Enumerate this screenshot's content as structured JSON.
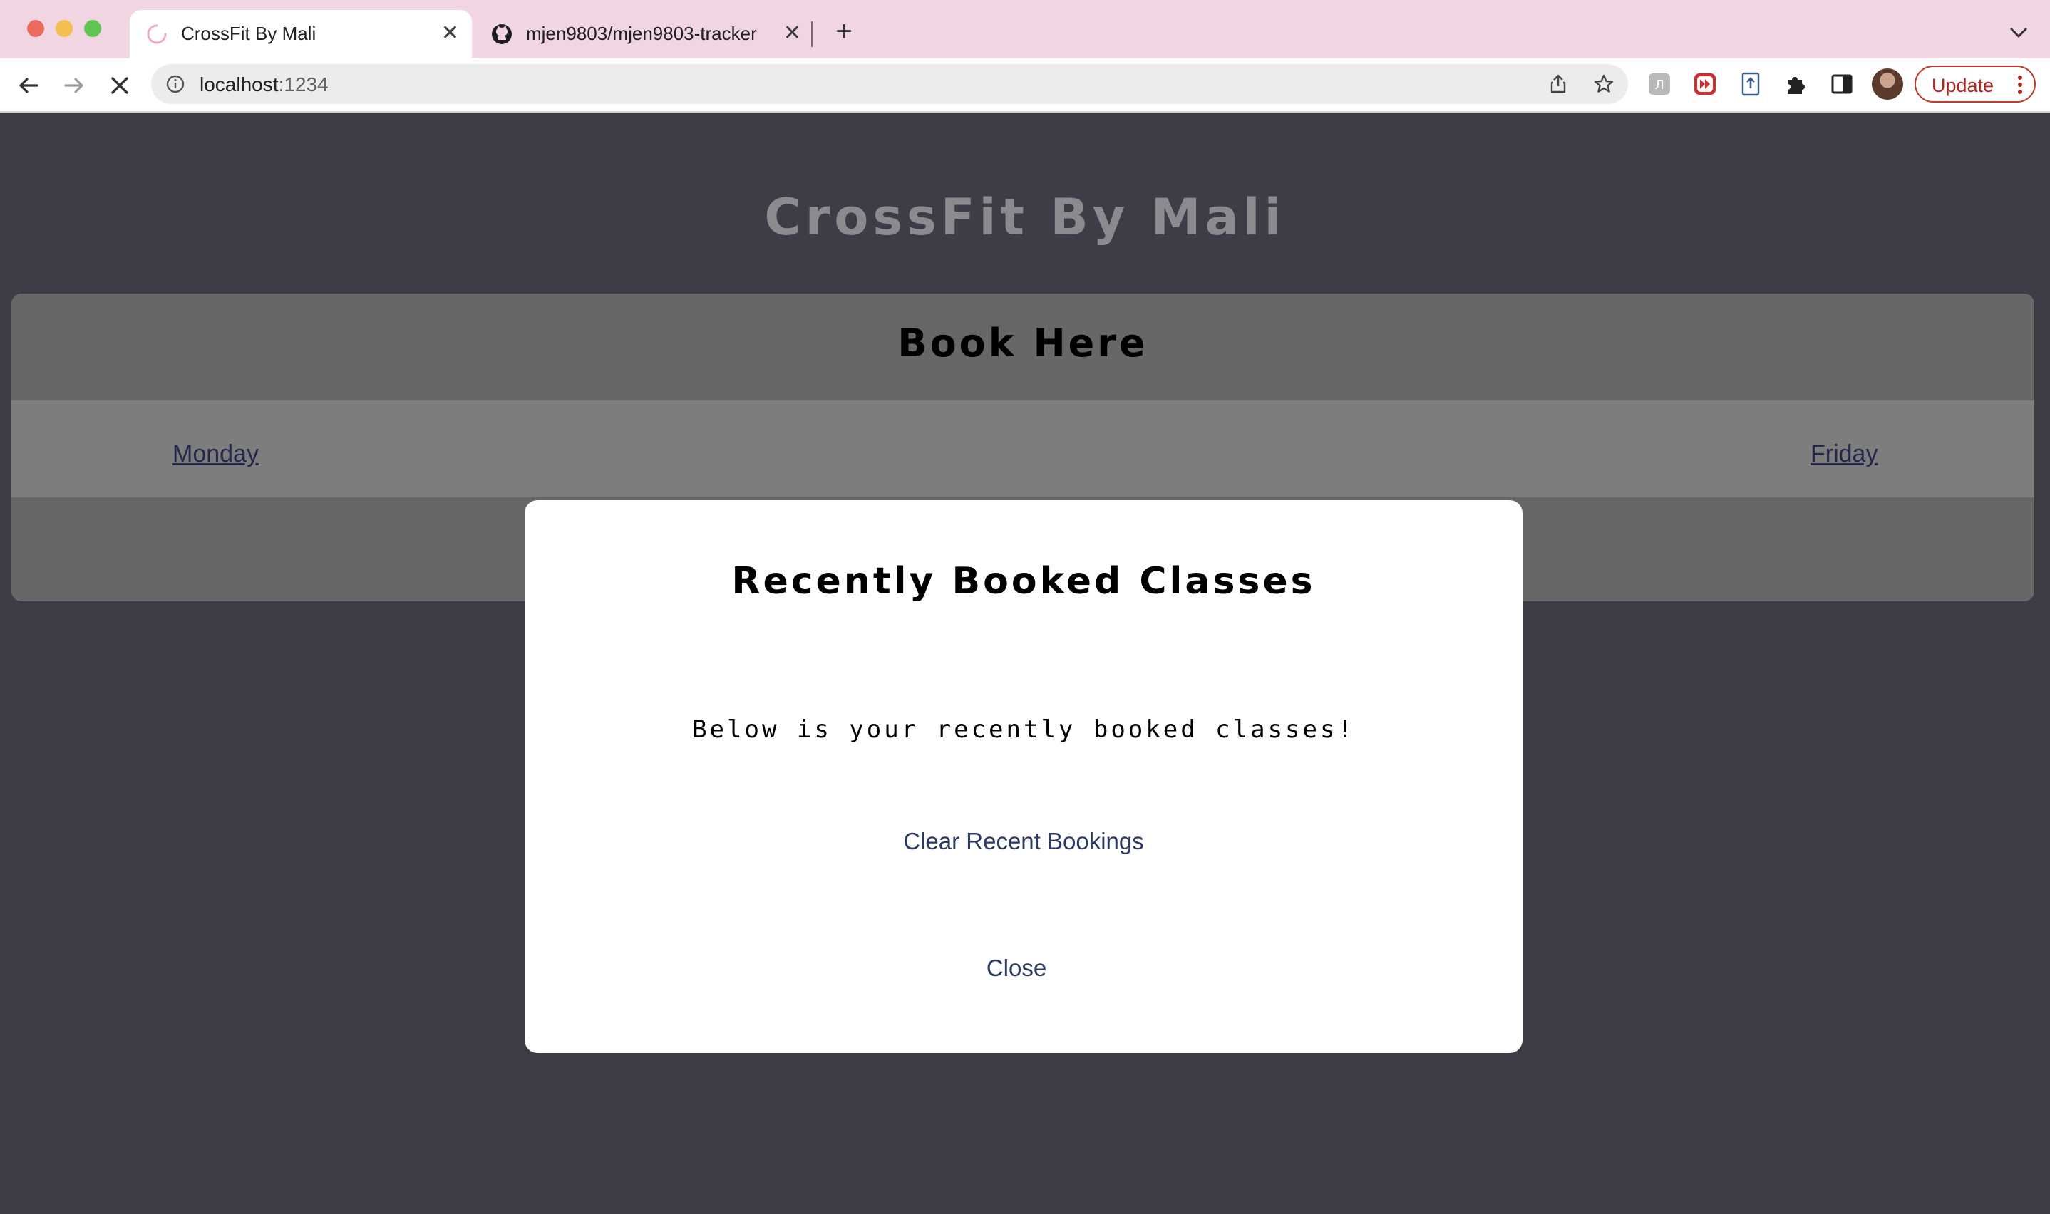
{
  "browser": {
    "tabs": [
      {
        "title": "CrossFit By Mali",
        "active": true,
        "icon": "loading-spinner-icon"
      },
      {
        "title": "mjen9803/mjen9803-tracker",
        "active": false,
        "icon": "github-icon"
      }
    ],
    "url_host": "localhost",
    "url_port": ":1234",
    "update_label": "Update",
    "colors": {
      "tabbar": "#f2d5e3",
      "update_accent": "#b3261e"
    }
  },
  "page": {
    "site_title": "CrossFit By Mali",
    "booking_heading": "Book Here",
    "days": [
      "Monday",
      "Friday"
    ],
    "colors": {
      "background": "#3d3d47",
      "panel": "#676767",
      "day_row": "#7d7d7d",
      "link": "#24264a"
    }
  },
  "modal": {
    "title": "Recently Booked Classes",
    "text": "Below is your recently booked classes!",
    "clear_label": "Clear Recent Bookings",
    "close_label": "Close",
    "colors": {
      "button_text": "#2c3a63"
    }
  }
}
